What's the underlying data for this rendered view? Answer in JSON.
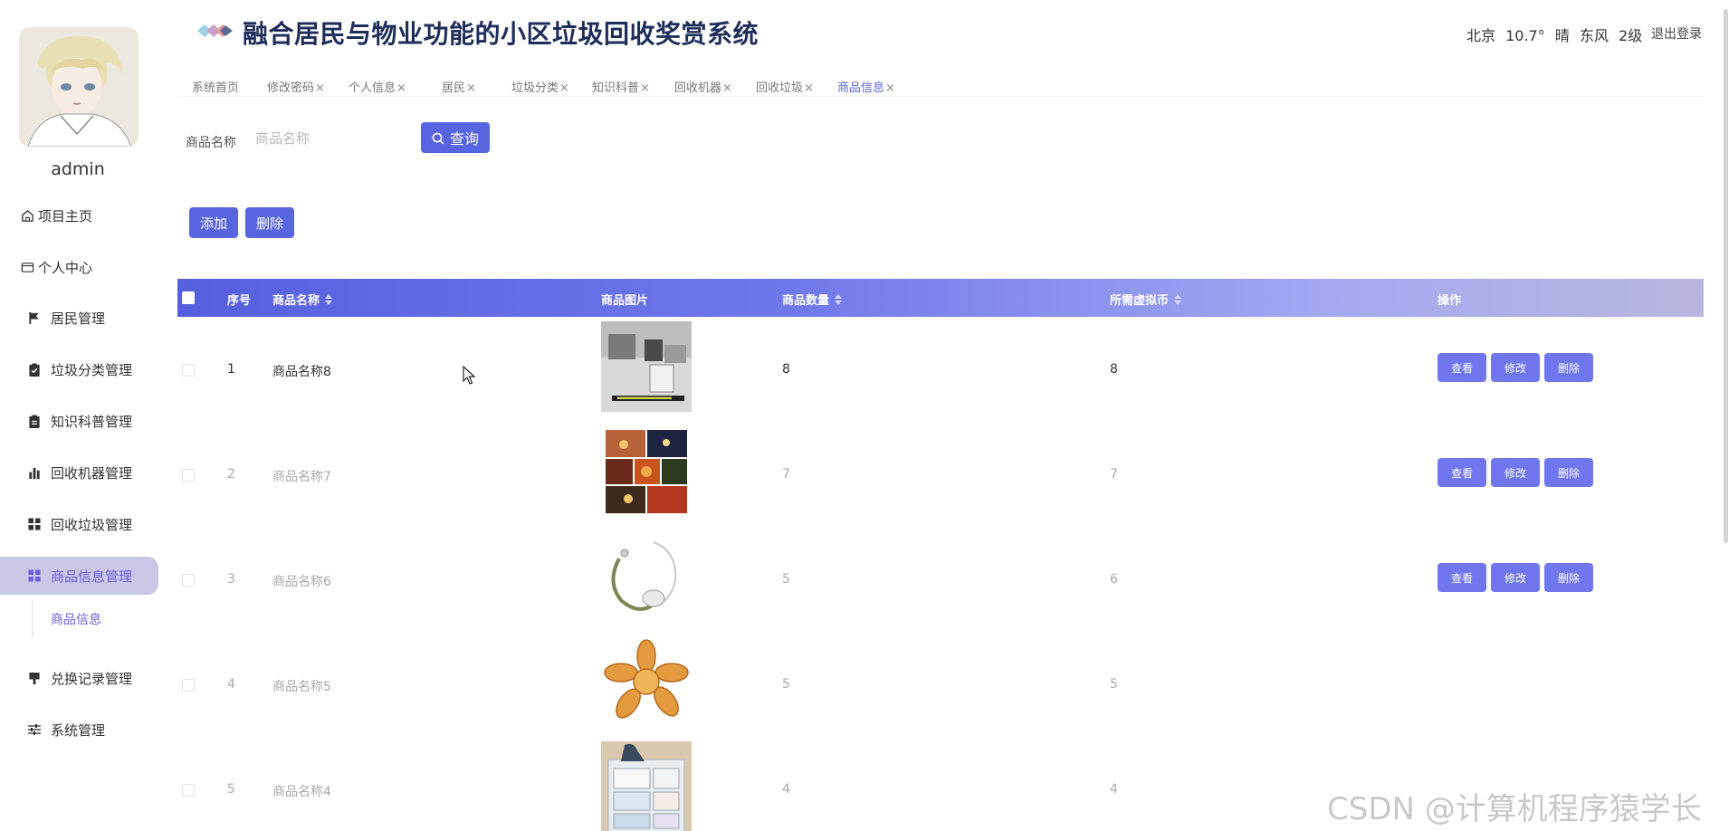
{
  "sidebar": {
    "username": "admin",
    "items": [
      {
        "label": "项目主页",
        "icon": "home-icon"
      },
      {
        "label": "个人中心",
        "icon": "id-card-icon"
      },
      {
        "label": "居民管理",
        "icon": "flag-icon"
      },
      {
        "label": "垃圾分类管理",
        "icon": "clipboard-check-icon"
      },
      {
        "label": "知识科普管理",
        "icon": "clipboard-icon"
      },
      {
        "label": "回收机器管理",
        "icon": "bar-chart-icon"
      },
      {
        "label": "回收垃圾管理",
        "icon": "grid-icon"
      },
      {
        "label": "商品信息管理",
        "icon": "grid-icon"
      },
      {
        "label": "兑换记录管理",
        "icon": "brush-icon"
      },
      {
        "label": "系统管理",
        "icon": "sliders-icon"
      }
    ],
    "subitem": "商品信息"
  },
  "header": {
    "title": "融合居民与物业功能的小区垃圾回收奖赏系统",
    "weather": {
      "city": "北京",
      "temp": "10.7°",
      "condition": "晴",
      "wind": "东风",
      "level": "2级"
    },
    "logout": "退出登录"
  },
  "tabs": [
    {
      "label": "系统首页",
      "closable": false
    },
    {
      "label": "修改密码",
      "closable": true
    },
    {
      "label": "个人信息",
      "closable": true
    },
    {
      "label": "居民",
      "closable": true
    },
    {
      "label": "垃圾分类",
      "closable": true
    },
    {
      "label": "知识科普",
      "closable": true
    },
    {
      "label": "回收机器",
      "closable": true
    },
    {
      "label": "回收垃圾",
      "closable": true
    },
    {
      "label": "商品信息",
      "closable": true
    }
  ],
  "tab_close": "×",
  "search": {
    "label": "商品名称",
    "placeholder": "商品名称",
    "value": "",
    "button": "查询"
  },
  "actions": {
    "add": "添加",
    "delete": "删除"
  },
  "table": {
    "headers": {
      "index": "序号",
      "name": "商品名称",
      "image": "商品图片",
      "qty": "商品数量",
      "coins": "所需虚拟币",
      "ops": "操作"
    },
    "row_actions": {
      "view": "查看",
      "edit": "修改",
      "delete": "删除"
    },
    "rows": [
      {
        "index": "1",
        "name": "商品名称8",
        "qty": "8",
        "coins": "8"
      },
      {
        "index": "2",
        "name": "商品名称7",
        "qty": "7",
        "coins": "7"
      },
      {
        "index": "3",
        "name": "商品名称6",
        "qty": "5",
        "coins": "6"
      },
      {
        "index": "4",
        "name": "商品名称5",
        "qty": "5",
        "coins": "5"
      },
      {
        "index": "5",
        "name": "商品名称4",
        "qty": "4",
        "coins": "4"
      }
    ]
  },
  "watermark": "CSDN @计算机程序猿学长",
  "colors": {
    "accent": "#5865e0",
    "active_menu_bg": "#c9c6e6",
    "active_text": "#6a5fdd",
    "title": "#1f2d5a"
  }
}
